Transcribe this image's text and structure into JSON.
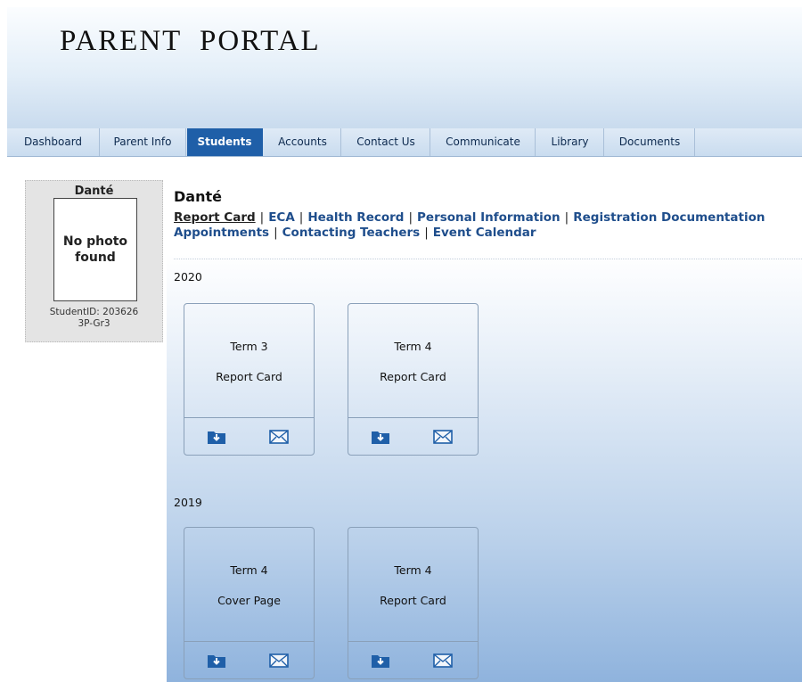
{
  "header": {
    "title": "PARENT  PORTAL"
  },
  "nav": {
    "items": [
      {
        "label": "Dashboard",
        "active": false
      },
      {
        "label": "Parent Info",
        "active": false
      },
      {
        "label": "Students",
        "active": true
      },
      {
        "label": "Accounts",
        "active": false
      },
      {
        "label": "Contact Us",
        "active": false
      },
      {
        "label": "Communicate",
        "active": false
      },
      {
        "label": "Library",
        "active": false
      },
      {
        "label": "Documents",
        "active": false
      }
    ]
  },
  "student": {
    "name": "Danté",
    "photo_text": "No photo found",
    "student_id": "StudentID: 203626",
    "class": "3P-Gr3"
  },
  "main": {
    "title": "Danté",
    "links_row1": [
      "Report Card",
      "ECA",
      "Health Record",
      "Personal Information",
      "Registration Documentation"
    ],
    "links_row2": [
      "Appointments",
      "Contacting Teachers",
      "Event Calendar"
    ],
    "current_link": "Report Card",
    "years": [
      {
        "year": "2020",
        "cards": [
          {
            "term": "Term 3",
            "type": "Report Card"
          },
          {
            "term": "Term 4",
            "type": "Report Card"
          }
        ]
      },
      {
        "year": "2019",
        "cards": [
          {
            "term": "Term 4",
            "type": "Cover Page"
          },
          {
            "term": "Term 4",
            "type": "Report Card"
          }
        ]
      }
    ]
  },
  "colors": {
    "nav_active": "#1f5fa8",
    "link": "#1f4e8c",
    "icon_blue": "#1f5fa8"
  },
  "icons": {
    "download": "folder-download-icon",
    "email": "envelope-icon"
  }
}
